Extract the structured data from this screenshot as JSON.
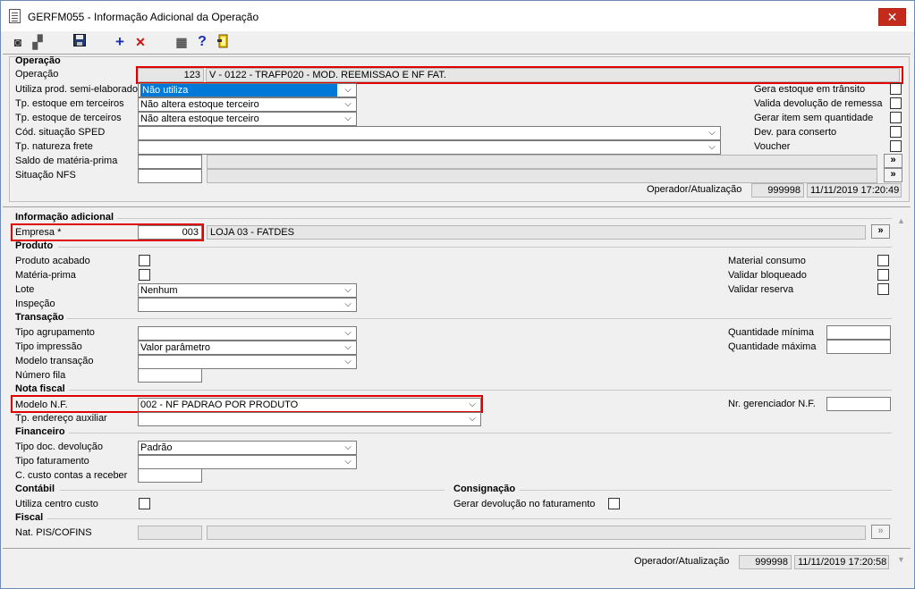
{
  "window": {
    "title": "GERFM055 - Informação Adicional da Operação",
    "close_label": "✕"
  },
  "toolbar": {
    "buttons": [
      {
        "name": "first-record-icon",
        "glyph": "◙"
      },
      {
        "name": "tree-icon",
        "glyph": "▞"
      },
      {
        "name": "save-icon",
        "glyph": "💾"
      },
      {
        "name": "add-icon",
        "glyph": "+"
      },
      {
        "name": "delete-icon",
        "glyph": "✕"
      },
      {
        "name": "grid-icon",
        "glyph": "▦"
      },
      {
        "name": "help-icon",
        "glyph": "?"
      },
      {
        "name": "exit-icon",
        "glyph": "⍈"
      }
    ]
  },
  "operacao": {
    "section": "Operação",
    "label": "Operação",
    "code": "123",
    "description": "V - 0122 - TRAFP020 - MOD. REEMISSAO  E NF FAT.",
    "semi_label": "Utiliza prod. semi-elaborado",
    "semi_value": "Não utiliza",
    "estoque_em_label": "Tp. estoque em terceiros",
    "estoque_em_value": "Não altera estoque terceiro",
    "estoque_de_label": "Tp. estoque de terceiros",
    "estoque_de_value": "Não altera estoque terceiro",
    "sped_label": "Cód. situação SPED",
    "sped_value": "",
    "frete_label": "Tp. natureza frete",
    "frete_value": "",
    "saldo_label": "Saldo de matéria-prima",
    "nfs_label": "Situação NFS",
    "more_label": "»",
    "gera_estoque": "Gera estoque em trânsito",
    "valida_dev": "Valida devolução de remessa",
    "gerar_item": "Gerar item sem quantidade",
    "dev_conserto": "Dev. para conserto",
    "voucher": "Voucher",
    "operador_label": "Operador/Atualização",
    "operador_code": "999998",
    "operador_date": "11/11/2019 17:20:49"
  },
  "info": {
    "section": "Informação adicional",
    "empresa_label": "Empresa *",
    "empresa_code": "003",
    "empresa_desc": "LOJA 03 - FATDES",
    "more_label": "»"
  },
  "produto": {
    "section": "Produto",
    "acabado": "Produto acabado",
    "materia": "Matéria-prima",
    "lote_label": "Lote",
    "lote_value": "Nenhum",
    "inspecao_label": "Inspeção",
    "inspecao_value": "",
    "material_consumo": "Material consumo",
    "validar_bloqueado": "Validar bloqueado",
    "validar_reserva": "Validar reserva"
  },
  "transacao": {
    "section": "Transação",
    "agrupamento_label": "Tipo agrupamento",
    "agrupamento_value": "",
    "impressao_label": "Tipo impressão",
    "impressao_value": "Valor parâmetro",
    "modelo_label": "Modelo transação",
    "modelo_value": "",
    "fila_label": "Número fila",
    "qtd_min_label": "Quantidade mínima",
    "qtd_max_label": "Quantidade máxima"
  },
  "nota": {
    "section": "Nota fiscal",
    "modelo_label": "Modelo N.F.",
    "modelo_value": "002 - NF PADRAO POR PRODUTO",
    "endereco_label": "Tp. endereço auxiliar",
    "endereco_value": "",
    "gerenciador_label": "Nr. gerenciador N.F."
  },
  "financeiro": {
    "section": "Financeiro",
    "devolucao_label": "Tipo doc. devolução",
    "devolucao_value": "Padrão",
    "faturamento_label": "Tipo faturamento",
    "faturamento_value": "",
    "custo_label": "C. custo contas a receber"
  },
  "contabil": {
    "section": "Contábil",
    "centro_label": "Utiliza centro custo"
  },
  "consignacao": {
    "section": "Consignação",
    "gerar_label": "Gerar devolução no faturamento"
  },
  "fiscal": {
    "section": "Fiscal",
    "pis_label": "Nat. PIS/COFINS",
    "more_label": "»"
  },
  "footer": {
    "operador_label": "Operador/Atualização",
    "operador_code": "999998",
    "operador_date": "11/11/2019 17:20:58"
  },
  "colors": {
    "accent": "#0078d7",
    "highlight_border": "#e00000",
    "close": "#c42b1c"
  }
}
